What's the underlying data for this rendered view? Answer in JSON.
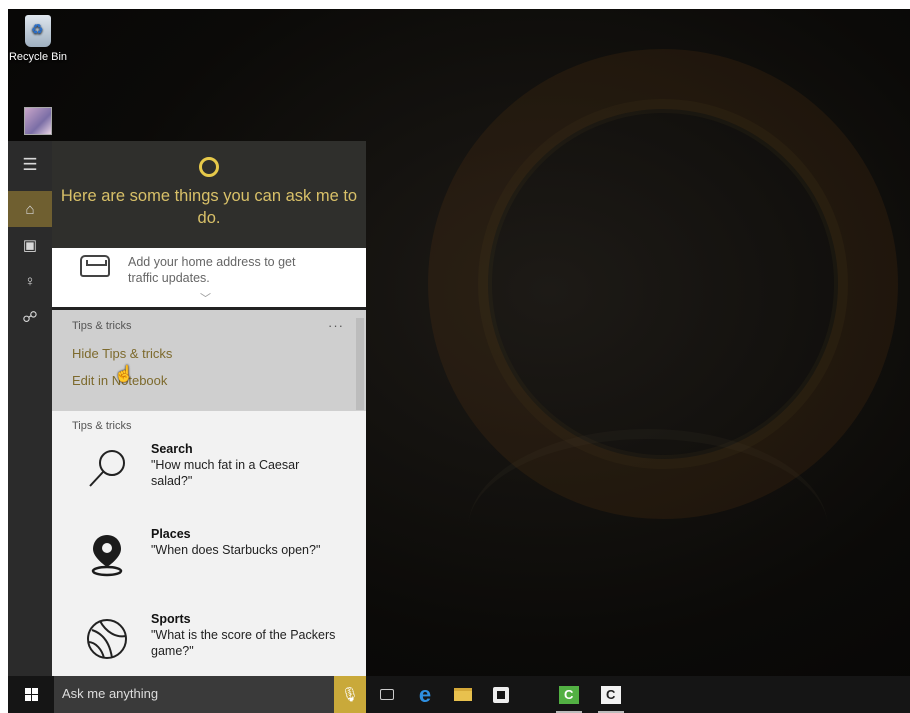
{
  "desktop": {
    "recycle_bin_label": "Recycle Bin"
  },
  "cortana": {
    "header": "Here are some things you can ask me to do.",
    "traffic_card": "Add your home address to get traffic updates.",
    "tips_menu": {
      "label": "Tips & tricks",
      "more": "···",
      "hide": "Hide Tips & tricks",
      "edit": "Edit in Notebook"
    },
    "tips": {
      "section_label": "Tips & tricks",
      "items": [
        {
          "title": "Search",
          "body": "\"How much fat in a Caesar salad?\"",
          "icon": "magnifier-icon"
        },
        {
          "title": "Places",
          "body": "\"When does Starbucks open?\"",
          "icon": "place-pin-icon"
        },
        {
          "title": "Sports",
          "body": "\"What is the score of the Packers game?\"",
          "icon": "ball-icon"
        }
      ]
    }
  },
  "taskbar": {
    "search_placeholder": "Ask me anything"
  },
  "colors": {
    "accent": "#6f5f30",
    "cortana_text": "#d8c068",
    "link": "#7d6a2d"
  }
}
